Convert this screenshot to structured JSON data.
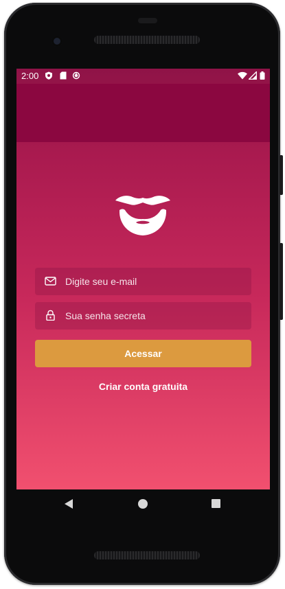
{
  "status_bar": {
    "time": "2:00",
    "left_icons": [
      "shield-icon",
      "sd-card-icon",
      "sync-icon"
    ],
    "right_icons": [
      "wifi-icon",
      "signal-icon",
      "battery-icon"
    ]
  },
  "login": {
    "logo_icon": "mustache-beard-icon",
    "email_placeholder": "Digite seu e-mail",
    "password_placeholder": "Sua senha secreta",
    "submit_label": "Acessar",
    "signup_link": "Criar conta gratuita"
  },
  "nav_bar": {
    "icons": [
      "back-icon",
      "home-icon",
      "recents-icon"
    ]
  },
  "colors": {
    "gradient_top": "#8f1347",
    "gradient_bottom": "#f1506f",
    "button": "#dc9a3f",
    "text": "#ffffff"
  }
}
